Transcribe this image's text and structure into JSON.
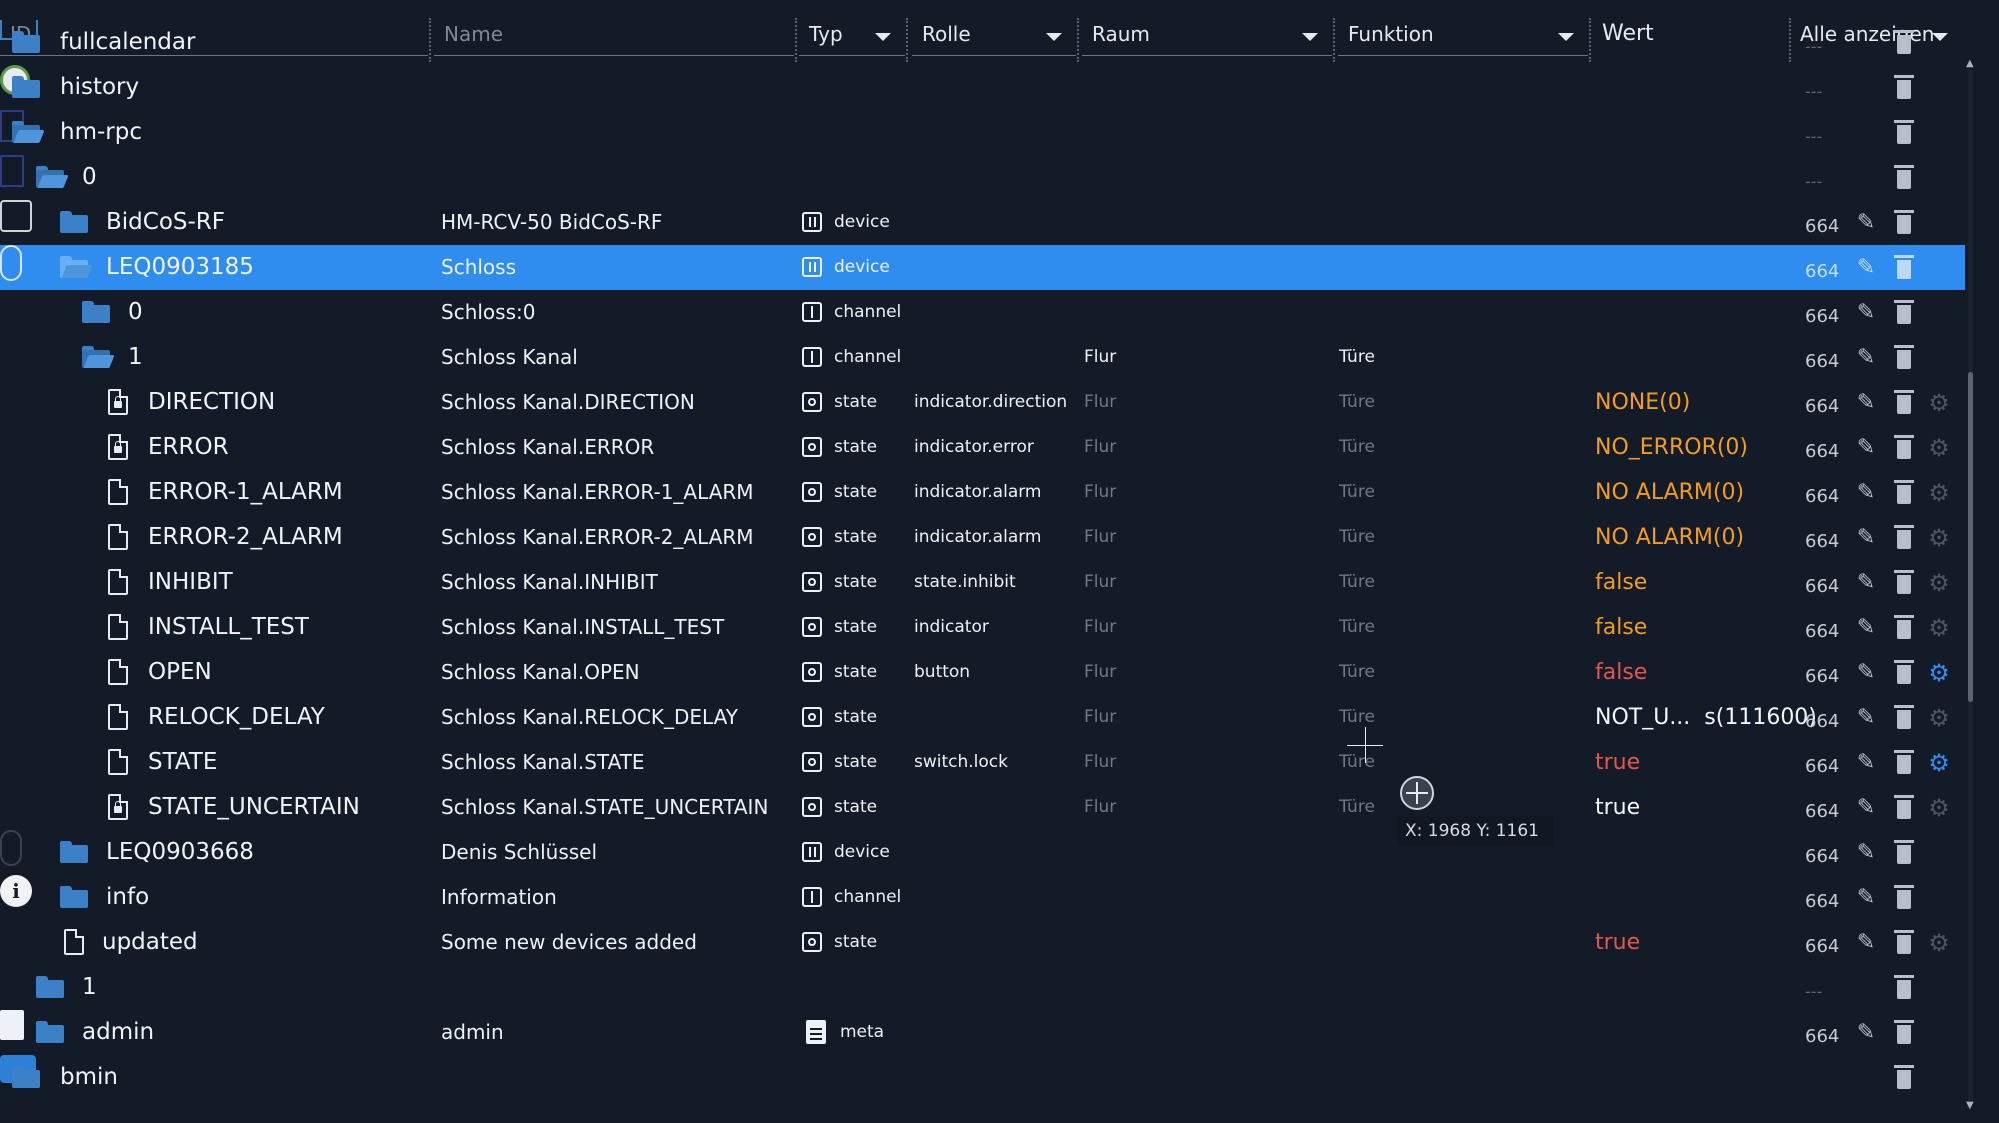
{
  "header": {
    "id_placeholder": "ID",
    "name_placeholder": "Name",
    "typ": "Typ",
    "rolle": "Rolle",
    "raum": "Raum",
    "funktion": "Funktion",
    "wert": "Wert",
    "alle": "Alle anzeigen"
  },
  "rows": [
    {
      "id": "fullcalendar",
      "name": "",
      "type": "",
      "role": "",
      "room": "",
      "func": "",
      "value": "",
      "acl": "---"
    },
    {
      "id": "history",
      "name": "",
      "type": "",
      "role": "",
      "room": "",
      "func": "",
      "value": "",
      "acl": "---"
    },
    {
      "id": "hm-rpc",
      "name": "",
      "type": "",
      "role": "",
      "room": "",
      "func": "",
      "value": "",
      "acl": "---"
    },
    {
      "id": "0",
      "name": "",
      "type": "",
      "role": "",
      "room": "",
      "func": "",
      "value": "",
      "acl": "---"
    },
    {
      "id": "BidCoS-RF",
      "name": "HM-RCV-50 BidCoS-RF",
      "type": "device",
      "role": "",
      "room": "",
      "func": "",
      "value": "",
      "acl": "664"
    },
    {
      "id": "LEQ0903185",
      "name": "Schloss",
      "type": "device",
      "role": "",
      "room": "",
      "func": "",
      "value": "",
      "acl": "664"
    },
    {
      "id": "0",
      "name": "Schloss:0",
      "type": "channel",
      "role": "",
      "room": "",
      "func": "",
      "value": "",
      "acl": "664"
    },
    {
      "id": "1",
      "name": "Schloss Kanal",
      "type": "channel",
      "role": "",
      "room": "Flur",
      "func": "Türe",
      "value": "",
      "acl": "664"
    },
    {
      "id": "DIRECTION",
      "name": "Schloss Kanal.DIRECTION",
      "type": "state",
      "role": "indicator.direction",
      "room": "Flur",
      "func": "Türe",
      "value": "NONE(0)",
      "acl": "664"
    },
    {
      "id": "ERROR",
      "name": "Schloss Kanal.ERROR",
      "type": "state",
      "role": "indicator.error",
      "room": "Flur",
      "func": "Türe",
      "value": "NO_ERROR(0)",
      "acl": "664"
    },
    {
      "id": "ERROR-1_ALARM",
      "name": "Schloss Kanal.ERROR-1_ALARM",
      "type": "state",
      "role": "indicator.alarm",
      "room": "Flur",
      "func": "Türe",
      "value": "NO ALARM(0)",
      "acl": "664"
    },
    {
      "id": "ERROR-2_ALARM",
      "name": "Schloss Kanal.ERROR-2_ALARM",
      "type": "state",
      "role": "indicator.alarm",
      "room": "Flur",
      "func": "Türe",
      "value": "NO ALARM(0)",
      "acl": "664"
    },
    {
      "id": "INHIBIT",
      "name": "Schloss Kanal.INHIBIT",
      "type": "state",
      "role": "state.inhibit",
      "room": "Flur",
      "func": "Türe",
      "value": "false",
      "acl": "664"
    },
    {
      "id": "INSTALL_TEST",
      "name": "Schloss Kanal.INSTALL_TEST",
      "type": "state",
      "role": "indicator",
      "room": "Flur",
      "func": "Türe",
      "value": "false",
      "acl": "664"
    },
    {
      "id": "OPEN",
      "name": "Schloss Kanal.OPEN",
      "type": "state",
      "role": "button",
      "room": "Flur",
      "func": "Türe",
      "value": "false",
      "acl": "664"
    },
    {
      "id": "RELOCK_DELAY",
      "name": "Schloss Kanal.RELOCK_DELAY",
      "type": "state",
      "role": "",
      "room": "Flur",
      "func": "Türe",
      "value": "NOT_U...  s(111600)",
      "acl": "664"
    },
    {
      "id": "STATE",
      "name": "Schloss Kanal.STATE",
      "type": "state",
      "role": "switch.lock",
      "room": "Flur",
      "func": "Türe",
      "value": "true",
      "acl": "664"
    },
    {
      "id": "STATE_UNCERTAIN",
      "name": "Schloss Kanal.STATE_UNCERTAIN",
      "type": "state",
      "role": "",
      "room": "Flur",
      "func": "Türe",
      "value": "true",
      "acl": "664"
    },
    {
      "id": "LEQ0903668",
      "name": "Denis Schlüssel",
      "type": "device",
      "role": "",
      "room": "",
      "func": "",
      "value": "",
      "acl": "664"
    },
    {
      "id": "info",
      "name": "Information",
      "type": "channel",
      "role": "",
      "room": "",
      "func": "",
      "value": "",
      "acl": "664"
    },
    {
      "id": "updated",
      "name": "Some new devices added",
      "type": "state",
      "role": "",
      "room": "",
      "func": "",
      "value": "true",
      "acl": "664"
    },
    {
      "id": "1",
      "name": "",
      "type": "",
      "role": "",
      "room": "",
      "func": "",
      "value": "",
      "acl": "---"
    },
    {
      "id": "admin",
      "name": "admin",
      "type": "meta",
      "role": "",
      "room": "",
      "func": "",
      "value": "",
      "acl": "664"
    },
    {
      "id": "bmin",
      "name": "",
      "type": "",
      "role": "",
      "room": "",
      "func": "",
      "value": "",
      "acl": ""
    }
  ],
  "cursor": {
    "coord_label": "X: 1968 Y: 1161"
  },
  "icons": {
    "edit": "pencil-icon",
    "delete": "trash-icon",
    "settings": "gear-icon",
    "folder": "folder-icon",
    "file": "file-icon"
  },
  "colors": {
    "background": "#141b28",
    "selection": "#2f8df0",
    "value_orange": "#f39c1e",
    "value_red": "#e2574c",
    "accent": "#2f8df0"
  }
}
